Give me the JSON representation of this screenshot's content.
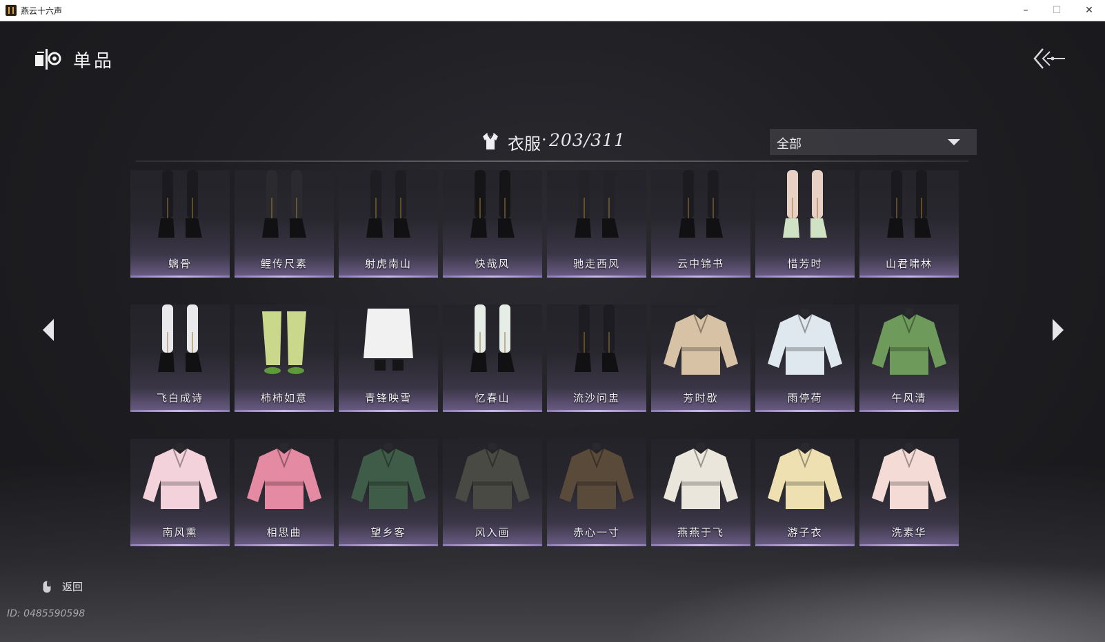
{
  "window": {
    "title": "燕云十六声",
    "min": "–",
    "max": "☐",
    "close": "✕"
  },
  "header": {
    "title": "单品"
  },
  "category": {
    "label": "衣服",
    "separator": "·",
    "count": "203/311"
  },
  "filter": {
    "value": "全部"
  },
  "items": [
    {
      "name": "螭骨",
      "art": "boots"
    },
    {
      "name": "鲤传尺素",
      "art": "boots"
    },
    {
      "name": "射虎南山",
      "art": "boots"
    },
    {
      "name": "快哉风",
      "art": "boots"
    },
    {
      "name": "驰走西风",
      "art": "boots"
    },
    {
      "name": "云中锦书",
      "art": "boots"
    },
    {
      "name": "惜芳时",
      "art": "shoes"
    },
    {
      "name": "山君啸林",
      "art": "boots"
    },
    {
      "name": "飞白成诗",
      "art": "boots"
    },
    {
      "name": "柿柿如意",
      "art": "pants"
    },
    {
      "name": "青锋映雪",
      "art": "skirt"
    },
    {
      "name": "忆春山",
      "art": "boots"
    },
    {
      "name": "流沙问盅",
      "art": "boots"
    },
    {
      "name": "芳时歇",
      "art": "robe"
    },
    {
      "name": "雨停荷",
      "art": "robe"
    },
    {
      "name": "午风清",
      "art": "robe"
    },
    {
      "name": "南风熏",
      "art": "robe"
    },
    {
      "name": "相思曲",
      "art": "robe"
    },
    {
      "name": "望乡客",
      "art": "robe"
    },
    {
      "name": "风入画",
      "art": "robe"
    },
    {
      "name": "赤心一寸",
      "art": "robe"
    },
    {
      "name": "燕燕于飞",
      "art": "robe"
    },
    {
      "name": "游子衣",
      "art": "robe"
    },
    {
      "name": "洗素华",
      "art": "robe"
    }
  ],
  "colors": [
    "#1b1a1f",
    "#2b2a2e",
    "#1e1d22",
    "#151417",
    "#232226",
    "#1c1b20",
    "#e8d0c4",
    "#1a191d",
    "#e9e9ec",
    "#c9d88a",
    "#f1f1f1",
    "#e6ece6",
    "#1d1c20",
    "#d7c2a5",
    "#dfe8ee",
    "#6e9a5c",
    "#f3d2dc",
    "#e48aa2",
    "#3e5c48",
    "#4a4a44",
    "#5a4a3a",
    "#ebe6dc",
    "#efe0b2",
    "#f5dbd6"
  ],
  "footer": {
    "back_label": "返回",
    "player_id": "ID: 0485590598"
  },
  "icons": [
    "app-icon",
    "wardrobe-icon",
    "back-arrow-icon",
    "clothing-icon",
    "caret-down-icon",
    "prev-page-icon",
    "next-page-icon",
    "mouse-icon"
  ]
}
